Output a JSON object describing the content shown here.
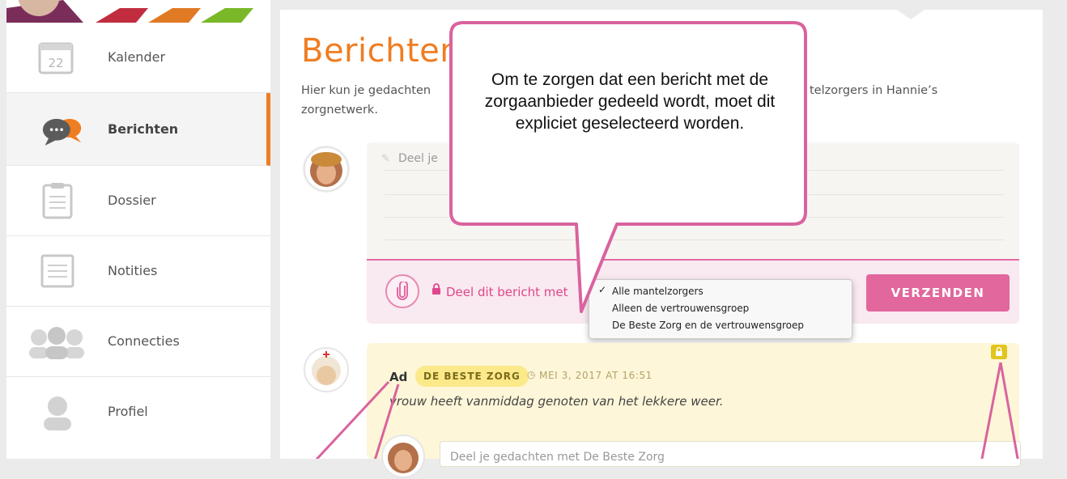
{
  "sidebar": {
    "items": [
      {
        "label": "Kalender",
        "icon": "calendar-icon",
        "icon_text": "22"
      },
      {
        "label": "Berichten",
        "icon": "chat-bubbles-icon",
        "active": true
      },
      {
        "label": "Dossier",
        "icon": "clipboard-icon"
      },
      {
        "label": "Notities",
        "icon": "notepad-icon"
      },
      {
        "label": "Connecties",
        "icon": "people-icon"
      },
      {
        "label": "Profiel",
        "icon": "person-icon"
      }
    ]
  },
  "main": {
    "title": "Berichten",
    "intro_a": "Hier kun je gedachten",
    "intro_b": "telzorgers in Hannie’s",
    "intro_c": "zorgnetwerk."
  },
  "composer": {
    "placeholder": "Deel je",
    "share_label": "Deel dit bericht met",
    "send_label": "VERZENDEN"
  },
  "share_dropdown": {
    "options": [
      "Alle mantelzorgers",
      "Alleen de vertrouwensgroep",
      "De Beste Zorg en de vertrouwensgroep"
    ],
    "selected_index": 0
  },
  "post": {
    "author": "Ad",
    "badge": "DE BESTE ZORG",
    "timestamp": "MEI 3, 2017 AT 16:51",
    "text": "vrouw heeft vanmiddag genoten van het lekkere weer.",
    "reply_placeholder": "Deel je gedachten met De Beste Zorg"
  },
  "callout": {
    "text": "Om te zorgen dat een bericht met de zorgaanbieder gedeeld wordt, moet dit expliciet geselecteerd worden."
  },
  "colors": {
    "orange": "#ef7d22",
    "pink": "#e2679d",
    "callout_border": "#d9639e",
    "post_bg": "#fdf6d8",
    "badge": "#fbe98a"
  }
}
